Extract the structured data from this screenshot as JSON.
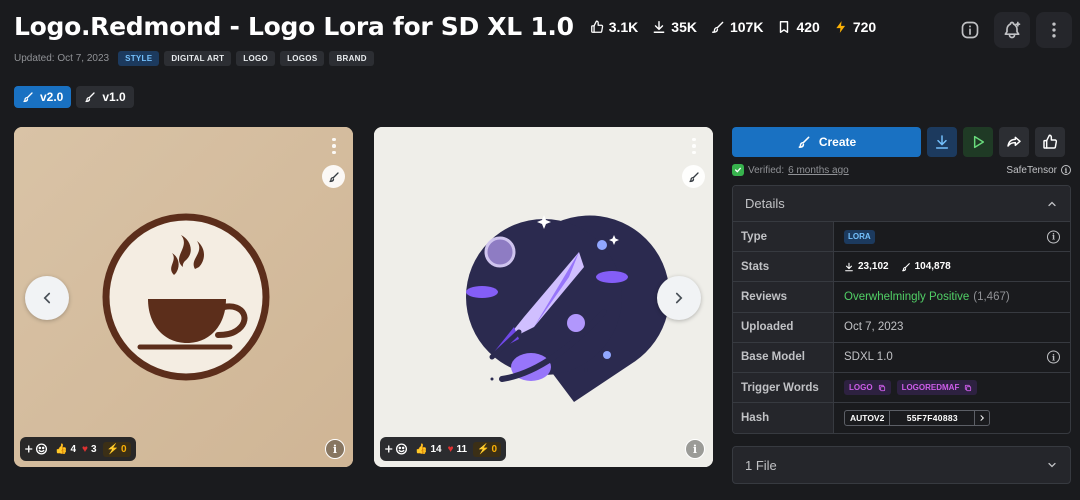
{
  "title": "Logo.Redmond - Logo Lora for SD XL 1.0",
  "stats": {
    "likes": "3.1K",
    "downloads": "35K",
    "generations": "107K",
    "bookmarks": "420",
    "buzz": "720"
  },
  "updated": "Updated: Oct 7, 2023",
  "tags": [
    "STYLE",
    "DIGITAL ART",
    "LOGO",
    "LOGOS",
    "BRAND"
  ],
  "versions": [
    {
      "label": "v2.0",
      "active": true
    },
    {
      "label": "v1.0",
      "active": false
    }
  ],
  "gallery": [
    {
      "reactions": {
        "thumbs": "4",
        "hearts": "3",
        "buzz": "0"
      }
    },
    {
      "reactions": {
        "thumbs": "14",
        "hearts": "11",
        "buzz": "0"
      }
    }
  ],
  "sidebar": {
    "create_label": "Create",
    "verified_prefix": "Verified:",
    "verified_time": "6 months ago",
    "safetensor": "SafeTensor",
    "details_label": "Details",
    "rows": {
      "type_key": "Type",
      "type_val": "LORA",
      "stats_key": "Stats",
      "stats_downloads": "23,102",
      "stats_generations": "104,878",
      "reviews_key": "Reviews",
      "reviews_val": "Overwhelmingly Positive",
      "reviews_count": "(1,467)",
      "uploaded_key": "Uploaded",
      "uploaded_val": "Oct 7, 2023",
      "base_key": "Base Model",
      "base_val": "SDXL 1.0",
      "trigger_key": "Trigger Words",
      "trigger_1": "LOGO",
      "trigger_2": "LOGOREDMAF",
      "hash_key": "Hash",
      "hash_type": "AUTOV2",
      "hash_val": "55F7F40883"
    },
    "files_label": "1 File"
  },
  "colors": {
    "background": "#1a1b1e",
    "accent": "#1971c2",
    "positive": "#51cf66",
    "buzz": "#fab005"
  }
}
